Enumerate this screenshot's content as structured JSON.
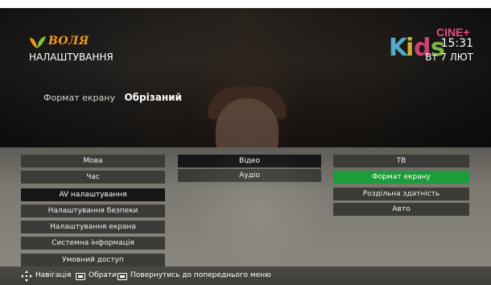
{
  "header": {
    "brand_name": "ВОЛЯ",
    "page_title": "НАЛАШТУВАННЯ",
    "channel_logo": {
      "kids": "Kids",
      "cine": "CINE+"
    },
    "time": "15:31",
    "date": "Вт 7 ЛЮТ"
  },
  "current_setting": {
    "label": "Формат екрану",
    "value": "Обрізаний"
  },
  "menu": {
    "main": [
      {
        "label": "Мова"
      },
      {
        "label": "Час"
      },
      {
        "label": "AV налаштування",
        "state": "active"
      },
      {
        "label": "Налаштування безпеки"
      },
      {
        "label": "Налаштування екрана"
      },
      {
        "label": "Системна інформація"
      },
      {
        "label": "Умовний доступ"
      }
    ],
    "sub": [
      {
        "label": "Відео",
        "state": "active"
      },
      {
        "label": "Аудіо"
      }
    ],
    "options": [
      {
        "label": "ТВ"
      },
      {
        "label": "Формат екрану",
        "state": "selected"
      },
      {
        "label": "Роздільна здатність"
      },
      {
        "label": "Авто"
      }
    ]
  },
  "help": {
    "navigate": "Навігація",
    "ok": "Обрати",
    "back": "Повернутись до попереднього меню"
  },
  "colors": {
    "brand_orange": "#f29a1d",
    "brand_green": "#7dc242",
    "selected_green": "#1a9c3a",
    "active_item": "#161616",
    "menu_item": "#3c3b37"
  }
}
